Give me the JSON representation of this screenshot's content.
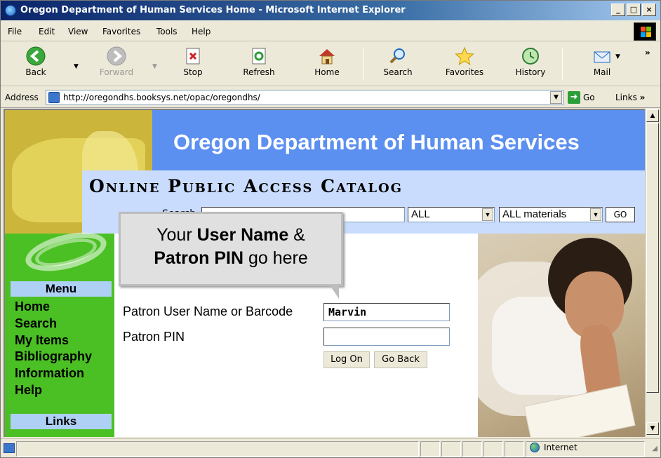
{
  "window": {
    "title": "Oregon Department of Human Services Home - Microsoft Internet Explorer"
  },
  "menubar": [
    "File",
    "Edit",
    "View",
    "Favorites",
    "Tools",
    "Help"
  ],
  "toolbar": {
    "back": "Back",
    "forward": "Forward",
    "stop": "Stop",
    "refresh": "Refresh",
    "home": "Home",
    "search": "Search",
    "favorites": "Favorites",
    "history": "History",
    "mail": "Mail"
  },
  "address": {
    "label": "Address",
    "url": "http://oregondhs.booksys.net/opac/oregondhs/",
    "go": "Go",
    "links": "Links"
  },
  "page": {
    "agency_title": "Oregon Department of Human Services",
    "catalog_title": "Online Public Access Catalog",
    "search_label": "Search",
    "search_scope": "ALL",
    "material_type": "ALL materials",
    "go_button": "GO"
  },
  "nav": {
    "menu_heading": "Menu",
    "items": [
      "Home",
      "Search",
      "My Items",
      "Bibliography",
      "Information",
      "Help"
    ],
    "links_heading": "Links"
  },
  "callout": {
    "line1_pre": "Your ",
    "line1_bold": "User Name",
    "line1_post": " &",
    "line2_bold": "Patron PIN",
    "line2_post": " go here"
  },
  "login": {
    "username_label": "Patron User Name or Barcode",
    "username_value": "Marvin",
    "pin_label": "Patron PIN",
    "pin_value": "",
    "logon_button": "Log On",
    "goback_button": "Go Back"
  },
  "statusbar": {
    "zone": "Internet"
  },
  "colors": {
    "header_blue": "#5b8ff0",
    "opac_band": "#c9dcfd",
    "nav_green": "#4bc024",
    "menu_head": "#aed0f4",
    "yellow": "#cbb63b"
  }
}
